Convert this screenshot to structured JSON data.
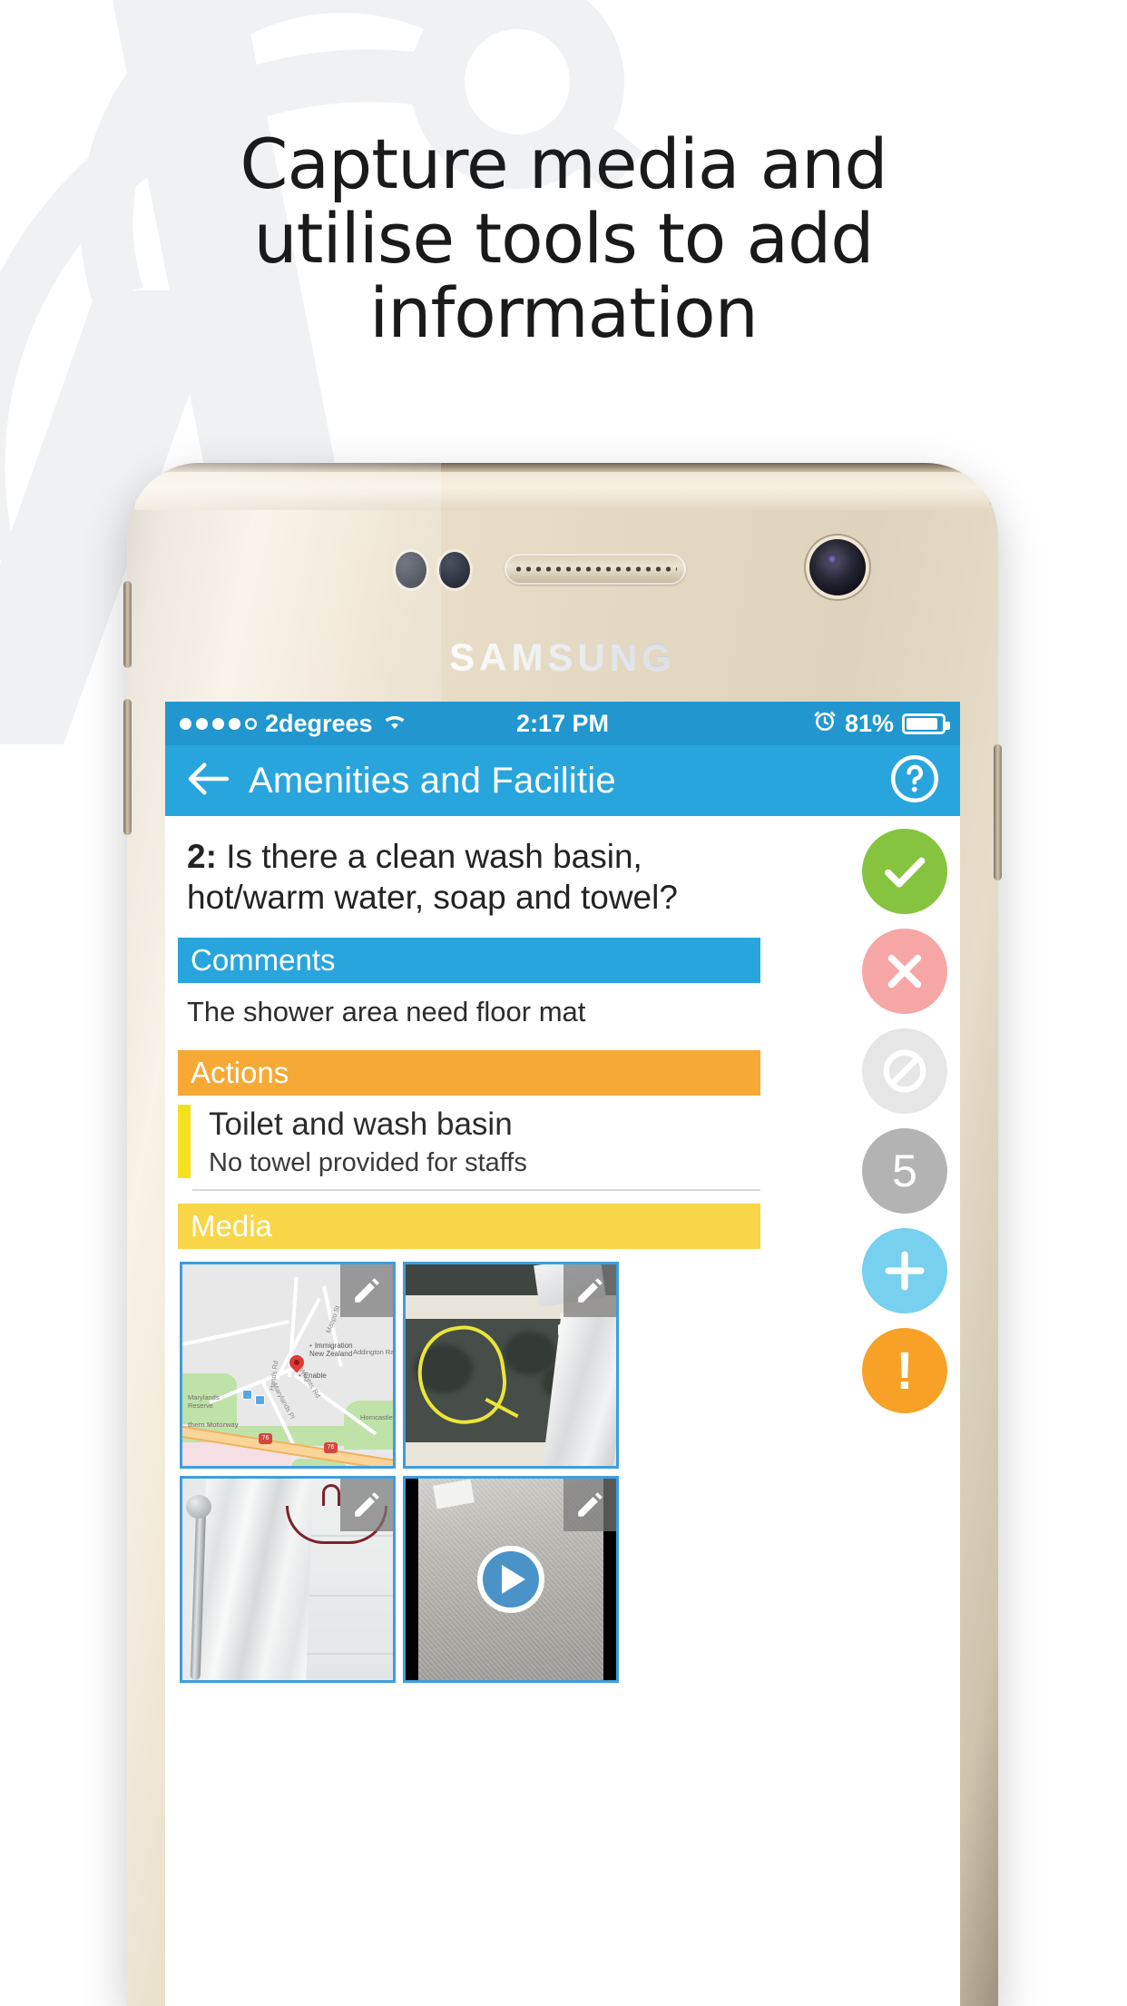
{
  "headline": {
    "line1": "Capture media and",
    "line2": "utilise tools to add",
    "line3": "information"
  },
  "device": {
    "brand": "SAMSUNG"
  },
  "status_bar": {
    "carrier": "2degrees",
    "wifi_icon": "wifi-icon",
    "time": "2:17 PM",
    "alarm_icon": "alarm-icon",
    "battery_percent": "81%",
    "signal_dots_filled": 4,
    "signal_dots_total": 5
  },
  "nav_bar": {
    "back_icon": "arrow-left-icon",
    "title": "Amenities and Facilitie",
    "help_icon": "question-circle-icon",
    "background_color": "#29a5dd"
  },
  "question": {
    "number": "2:",
    "text": "Is there a clean wash basin, hot/warm water, soap and towel?"
  },
  "sections": {
    "comments": {
      "header": "Comments",
      "header_color": "#29a5dd",
      "body": "The shower area need floor mat"
    },
    "actions": {
      "header": "Actions",
      "header_color": "#f7a936",
      "accent_color": "#f5e01e",
      "item_title": "Toilet and wash basin",
      "item_subtitle": "No towel provided for staffs"
    },
    "media": {
      "header": "Media",
      "header_color": "#f9d648",
      "items": [
        {
          "name": "map-thumbnail",
          "kind": "map",
          "edit_icon": "pencil-icon"
        },
        {
          "name": "wet-floor-photo-thumbnail",
          "kind": "photo",
          "edit_icon": "pencil-icon"
        },
        {
          "name": "shower-curtain-photo-thumbnail",
          "kind": "photo",
          "edit_icon": "pencil-icon"
        },
        {
          "name": "video-thumbnail",
          "kind": "video",
          "edit_icon": "pencil-icon",
          "play_icon": "play-icon"
        }
      ]
    }
  },
  "map_labels": {
    "pois": [
      "Immigration New Zealand",
      "Enable"
    ],
    "places": [
      "Addington Raceway",
      "Marylands Reserve",
      "Horncastle Are"
    ],
    "roads": [
      "Matipo St",
      "Wrights Rd",
      "Hands Rd",
      "Marylands Pl",
      "Southern Motorway"
    ],
    "shields": [
      "76",
      "76"
    ]
  },
  "side_actions": [
    {
      "name": "mark-compliant-button",
      "icon": "check-icon",
      "label": "",
      "color": "#86c440"
    },
    {
      "name": "mark-non-compliant-button",
      "icon": "cross-icon",
      "label": "",
      "color": "#f6a6a4"
    },
    {
      "name": "mark-not-applicable-button",
      "icon": "prohibited-icon",
      "label": "",
      "color": "#e6e6e6"
    },
    {
      "name": "score-badge",
      "icon": "number-badge",
      "label": "5",
      "color": "#b3b3b3"
    },
    {
      "name": "add-media-button",
      "icon": "plus-icon",
      "label": "",
      "color": "#76d0ee"
    },
    {
      "name": "raise-issue-button",
      "icon": "exclamation-icon",
      "label": "!",
      "color": "#f7a226"
    }
  ]
}
